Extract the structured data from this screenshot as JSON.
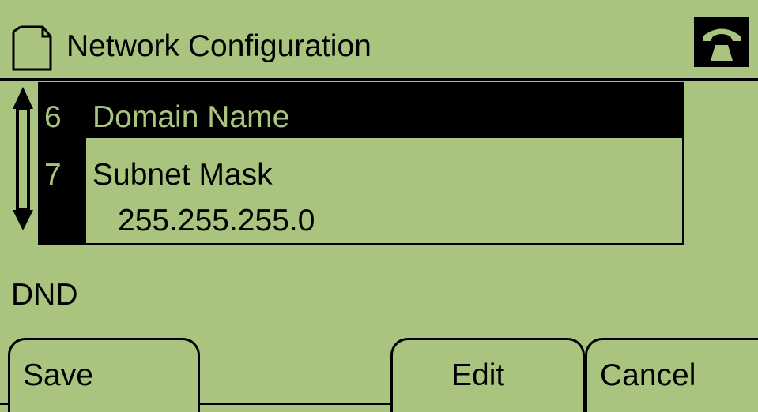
{
  "header": {
    "title": "Network Configuration",
    "left_icon": "document-icon",
    "right_icon": "phone-handset-icon"
  },
  "list": {
    "items": [
      {
        "number": "6",
        "label": "Domain Name",
        "selected": true
      },
      {
        "number": "7",
        "label": "Subnet Mask",
        "value": "255.255.255.0",
        "selected": false
      }
    ],
    "scroll_icon": "up-down-scroll-arrow-icon"
  },
  "status": {
    "dnd_label": "DND"
  },
  "softkeys": {
    "save": "Save",
    "edit": "Edit",
    "cancel": "Cancel"
  },
  "colors": {
    "lcd_background": "#a8c47e",
    "foreground": "#000000"
  }
}
